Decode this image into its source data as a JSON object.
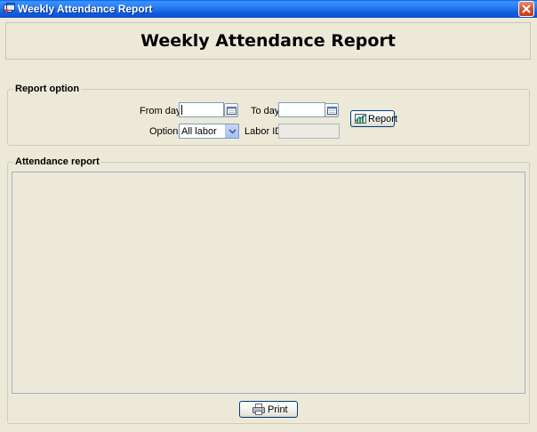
{
  "window": {
    "title": "Weekly Attendance Report",
    "icons": {
      "app": "app-window-icon",
      "close": "close-icon"
    }
  },
  "header": {
    "title": "Weekly Attendance Report"
  },
  "report_option": {
    "group_label": "Report option",
    "from_day": {
      "label": "From day:",
      "value": ""
    },
    "to_day": {
      "label": "To day:",
      "value": ""
    },
    "option": {
      "label": "Option:",
      "selected": "All labor"
    },
    "labor_id": {
      "label": "Labor ID:",
      "value": ""
    },
    "report_button": {
      "label": "Report",
      "icon": "report-chart-icon"
    },
    "calendar_icon": "calendar-icon"
  },
  "attendance": {
    "group_label": "Attendance report",
    "print_button": {
      "label": "Print",
      "icon": "printer-icon"
    }
  },
  "colors": {
    "titlebar": "#0a4fd0",
    "window_bg": "#ece9d8",
    "close_button": "#d9542e",
    "field_border": "#7f9db9"
  }
}
